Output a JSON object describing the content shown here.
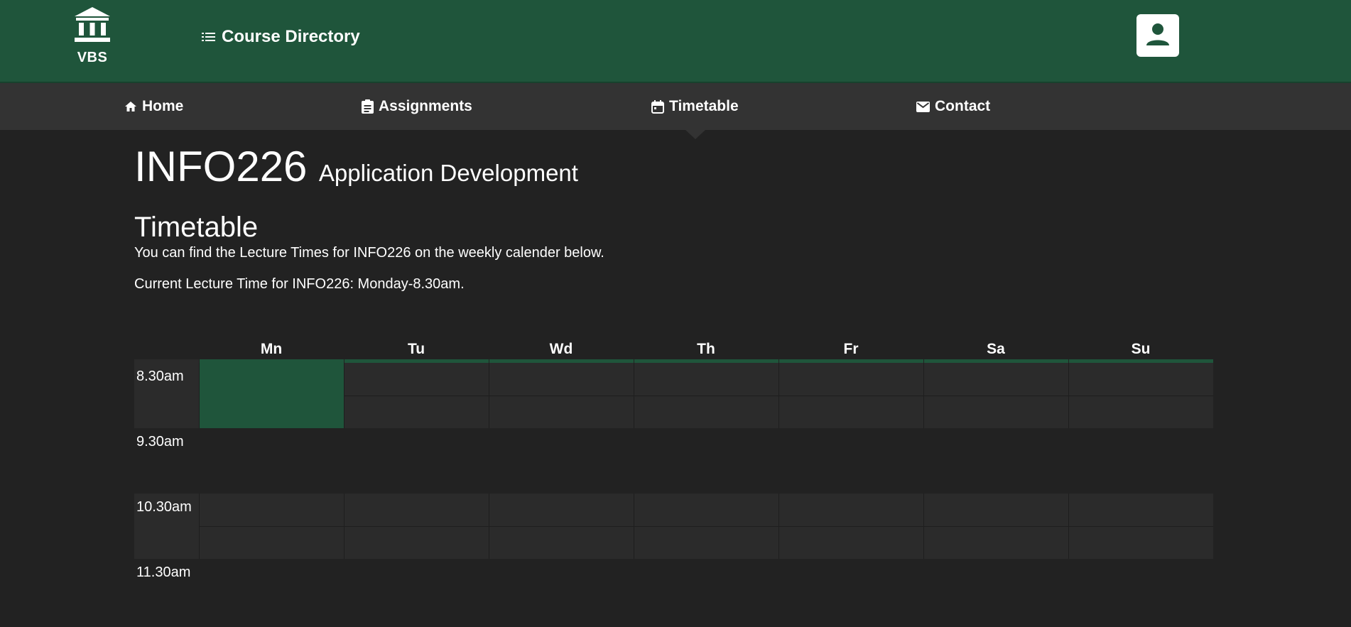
{
  "header": {
    "logo_text": "VBS",
    "logo_icon": "institution-icon",
    "course_directory_label": "Course Directory",
    "course_directory_icon": "list-icon",
    "profile_icon": "account-box-icon",
    "brand_color": "#1f553b"
  },
  "nav": {
    "items": [
      {
        "label": "Home",
        "icon": "home-icon"
      },
      {
        "label": "Assignments",
        "icon": "clipboard-icon"
      },
      {
        "label": "Timetable",
        "icon": "calendar-icon"
      },
      {
        "label": "Contact",
        "icon": "mail-icon"
      }
    ],
    "active": "Timetable"
  },
  "course": {
    "code": "INFO226",
    "name": "Application Development"
  },
  "page": {
    "title": "Timetable",
    "description": "You can find the Lecture Times for INFO226 on the weekly calender below.",
    "current_time": "Current Lecture Time for INFO226: Monday-8.30am."
  },
  "timetable": {
    "days": [
      "Mn",
      "Tu",
      "Wd",
      "Th",
      "Fr",
      "Sa",
      "Su"
    ],
    "times": [
      "8.30am",
      "9.30am",
      "10.30am",
      "11.30am"
    ],
    "booked": [
      {
        "day": "Mn",
        "time": "8.30am"
      }
    ],
    "booked_color": "#1f553b"
  }
}
